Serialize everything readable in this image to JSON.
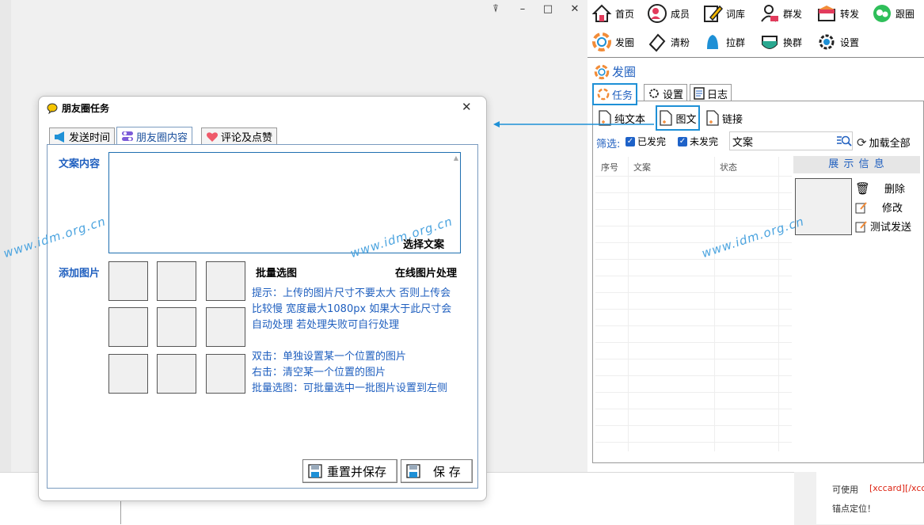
{
  "host": {
    "pin_glyph": "⍒",
    "min_glyph": "–",
    "max_glyph": "□",
    "close_glyph": "✕",
    "bottom_text_1": "可使用",
    "bottom_text_2": "[xccard][/xcc",
    "bottom_text_3": "锚点定位！"
  },
  "nav": [
    {
      "label": "首页",
      "icon": "home-icon"
    },
    {
      "label": "成员",
      "icon": "members-icon"
    },
    {
      "label": "词库",
      "icon": "pencil-icon"
    },
    {
      "label": "群发",
      "icon": "group-send-icon"
    },
    {
      "label": "转发",
      "icon": "forward-icon"
    },
    {
      "label": "跟圈",
      "icon": "follow-moments-icon"
    },
    {
      "label": "发圈",
      "icon": "moments-icon"
    },
    {
      "label": "清粉",
      "icon": "eraser-icon"
    },
    {
      "label": "拉群",
      "icon": "pull-group-icon"
    },
    {
      "label": "换群",
      "icon": "switch-group-icon"
    },
    {
      "label": "设置",
      "icon": "gear-icon"
    }
  ],
  "section_title": "发圈",
  "right_tabs": {
    "task": "任务",
    "settings": "设置",
    "log": "日志"
  },
  "content_types": {
    "plain": "纯文本",
    "image_text": "图文",
    "link": "链接"
  },
  "filter": {
    "label": "筛选:",
    "sent": "已发完",
    "unsent": "未发完",
    "search_value": "文案",
    "load_all": "加载全部"
  },
  "grid_headers": [
    "序号",
    "文案",
    "状态"
  ],
  "display_info": {
    "title": "展 示 信 息",
    "delete": "删除",
    "edit": "修改",
    "test_send": "测试发送"
  },
  "dialog": {
    "title": "朋友圈任务",
    "close_glyph": "✕",
    "tabs": [
      "发送时间",
      "朋友圈内容",
      "评论及点赞"
    ],
    "text_label": "文案内容",
    "select_text": "选择文案",
    "image_label": "添加图片",
    "batch_select": "批量选图",
    "online_process": "在线图片处理",
    "hints": [
      "提示：上传的图片尺寸不要太大 否则上传会",
      "比较慢 宽度最大1080px 如果大于此尺寸会",
      "自动处理 若处理失败可自行处理",
      "双击：单独设置某一个位置的图片",
      "右击：清空某一个位置的图片",
      "批量选图：可批量选中一批图片设置到左侧"
    ],
    "reset_save": "重置并保存",
    "save": "保 存"
  },
  "watermark": "www.idm.org.cn",
  "colors": {
    "accent": "#1e90d6",
    "link_blue": "#1f5fbf",
    "watermark": "#4aa3df"
  }
}
